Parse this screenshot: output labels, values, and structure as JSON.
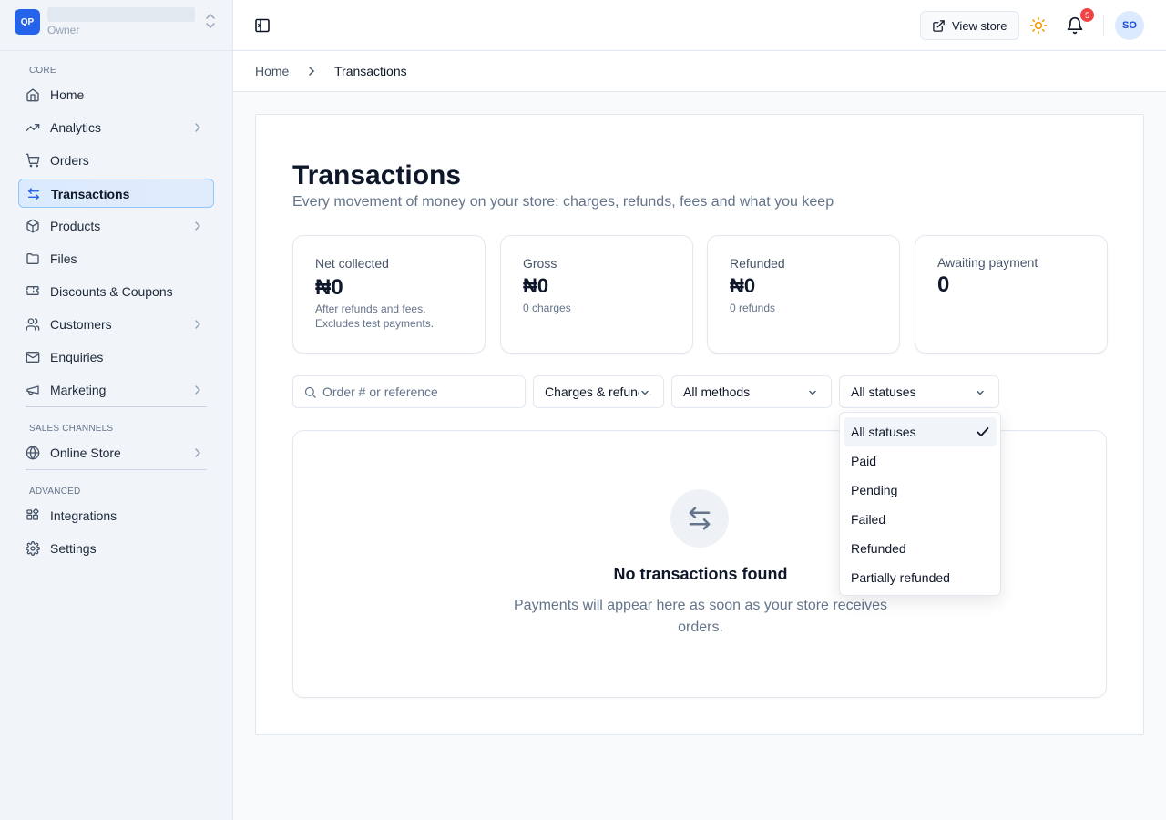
{
  "workspace": {
    "logo": "QP",
    "role": "Owner"
  },
  "sidebar": {
    "sections": {
      "core": "CORE",
      "sales_channels": "SALES CHANNELS",
      "advanced": "ADVANCED"
    },
    "items": [
      {
        "label": "Home",
        "icon": "home-icon"
      },
      {
        "label": "Analytics",
        "icon": "trend-icon"
      },
      {
        "label": "Orders",
        "icon": "cart-icon"
      },
      {
        "label": "Transactions",
        "icon": "transfer-icon",
        "active": true
      },
      {
        "label": "Products",
        "icon": "package-icon"
      },
      {
        "label": "Files",
        "icon": "folder-icon"
      },
      {
        "label": "Discounts & Coupons",
        "icon": "ticket-icon"
      },
      {
        "label": "Customers",
        "icon": "users-icon"
      },
      {
        "label": "Enquiries",
        "icon": "mail-icon"
      },
      {
        "label": "Marketing",
        "icon": "megaphone-icon"
      },
      {
        "label": "Online Store",
        "icon": "globe-icon"
      },
      {
        "label": "Integrations",
        "icon": "blocks-icon"
      },
      {
        "label": "Settings",
        "icon": "gear-icon"
      }
    ]
  },
  "topbar": {
    "view_store_label": "View store",
    "notification_count": "5",
    "avatar_initials": "SO"
  },
  "breadcrumb": {
    "home": "Home",
    "current": "Transactions"
  },
  "page": {
    "title": "Transactions",
    "subtitle": "Every movement of money on your store: charges, refunds, fees and what you keep"
  },
  "stats": [
    {
      "label": "Net collected",
      "value": "₦0",
      "note_line1": "After refunds and fees.",
      "note_line2": "Excludes test payments."
    },
    {
      "label": "Gross",
      "value": "₦0",
      "note_line1": "0 charges"
    },
    {
      "label": "Refunded",
      "value": "₦0",
      "note_line1": "0 refunds"
    },
    {
      "label": "Awaiting payment",
      "value": "0"
    }
  ],
  "filters": {
    "search_placeholder": "Order # or reference",
    "type_value": "Charges & refunds",
    "method_value": "All methods",
    "status_value": "All statuses"
  },
  "status_options": [
    "All statuses",
    "Paid",
    "Pending",
    "Failed",
    "Refunded",
    "Partially refunded"
  ],
  "status_selected_index": 0,
  "empty_state": {
    "title": "No transactions found",
    "description": "Payments will appear here as soon as your store receives orders."
  },
  "colors": {
    "accent": "#2563eb",
    "badge": "#ef4444",
    "active_bg": "#dbeafe",
    "sun": "#f59e0b"
  }
}
